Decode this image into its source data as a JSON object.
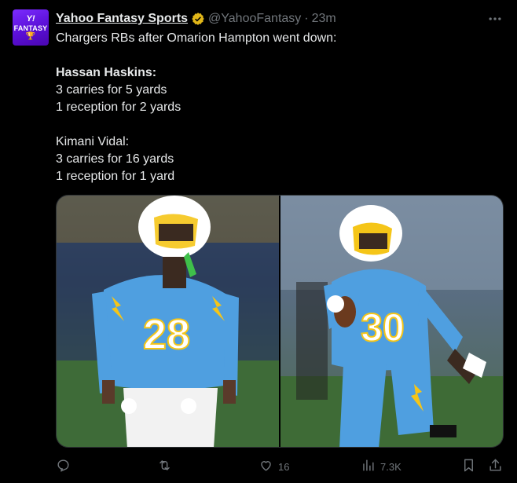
{
  "account": {
    "display_name": "Yahoo Fantasy Sports",
    "handle": "@YahooFantasy",
    "separator": "·",
    "time": "23m",
    "avatar_logo_text": "Y!",
    "avatar_text": "FANTASY",
    "verified_icon": "verified-badge-gold"
  },
  "tweet": {
    "line1": "Chargers RBs after Omarion Hampton went down:",
    "player1_name": "Hassan Haskins:",
    "player1_line1": "3 carries for 5 yards",
    "player1_line2": "1 reception for 2 yards",
    "player2_name": "Kimani Vidal:",
    "player2_line1": "3 carries for 16 yards",
    "player2_line2": "1 reception for 1 yard"
  },
  "media": {
    "left_jersey_number": "28",
    "right_jersey_number": "30",
    "team_colors": {
      "powder_blue": "#4f9fe0",
      "gold": "#f5c518",
      "white": "#ffffff"
    }
  },
  "actions": {
    "reply_count": "",
    "retweet_count": "",
    "like_count": "16",
    "views_count": "7.3K"
  },
  "colors": {
    "background": "#000000",
    "text": "#e7e9ea",
    "muted": "#71767b",
    "verified_gold": "#e2b719"
  }
}
